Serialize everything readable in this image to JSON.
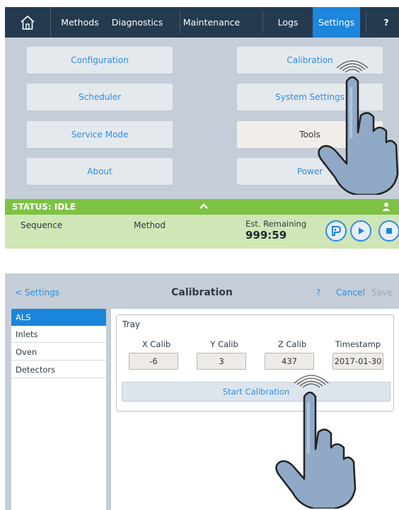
{
  "top_screen": {
    "nav": {
      "items": [
        "Methods",
        "Diagnostics",
        "Maintenance",
        "Logs",
        "Settings",
        "?"
      ],
      "active": "Settings"
    },
    "tiles": {
      "configuration": "Configuration",
      "calibration": "Calibration",
      "scheduler": "Scheduler",
      "system_settings": "System Settings",
      "service_mode": "Service Mode",
      "tools": "Tools",
      "about": "About",
      "power": "Power"
    },
    "status": {
      "label": "STATUS: IDLE"
    },
    "info": {
      "sequence": "Sequence",
      "method": "Method",
      "est_remaining_label": "Est. Remaining",
      "est_remaining_value": "999:59"
    }
  },
  "bottom_screen": {
    "header": {
      "back": "< Settings",
      "title": "Calibration",
      "help": "?",
      "cancel": "Cancel",
      "save": "Save"
    },
    "sidebar": {
      "items": [
        "ALS",
        "Inlets",
        "Oven",
        "Detectors"
      ],
      "selected": "ALS"
    },
    "tray": {
      "label": "Tray",
      "columns": [
        "X Calib",
        "Y Calib",
        "Z Calib",
        "Timestamp"
      ],
      "values": [
        "-6",
        "3",
        "437",
        "2017-01-30"
      ],
      "start_button": "Start Calibration"
    }
  },
  "colors": {
    "nav_bg": "#243a4e",
    "accent": "#1b86dc",
    "status_green": "#7dc243",
    "info_green": "#cfe6b6",
    "panel_bg": "#c5ced8"
  },
  "icons": [
    "home-icon",
    "chevron-up-icon",
    "user-icon",
    "pause-icon",
    "play-icon",
    "stop-icon",
    "pointing-hand-icon",
    "tap-ripple-icon"
  ]
}
